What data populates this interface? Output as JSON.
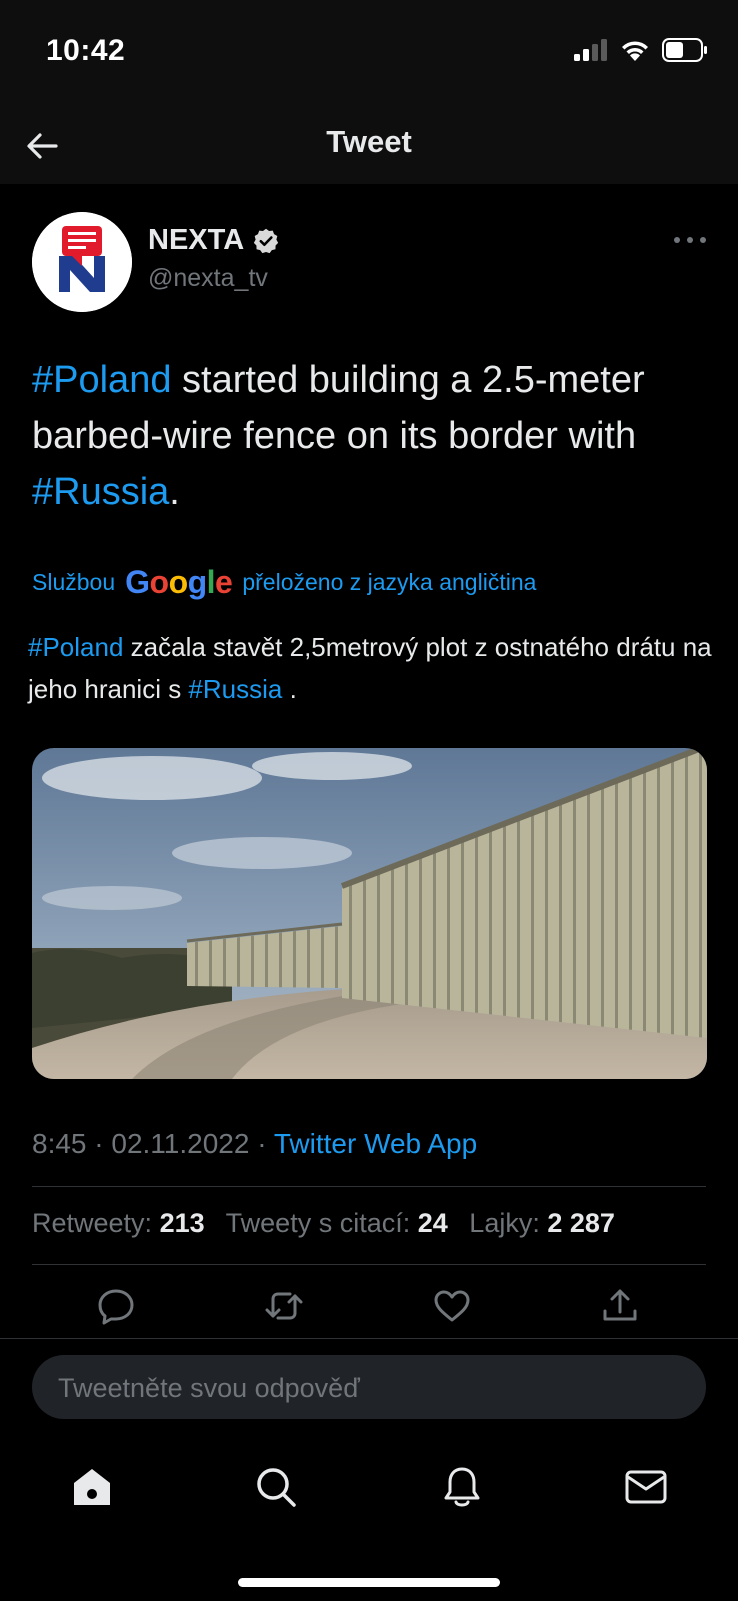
{
  "status_bar": {
    "time": "10:42"
  },
  "header": {
    "title": "Tweet"
  },
  "tweet": {
    "author_name": "NEXTA",
    "author_handle": "@nexta_tv",
    "text": {
      "hashtag1": "#Poland",
      "part1": " started building a 2.5-meter barbed-wire fence on its border with ",
      "hashtag2": "#Russia",
      "part2": "."
    },
    "translation": {
      "prefix": "Službou",
      "provider": "Google",
      "suffix": "přeloženo z jazyka angličtina",
      "hashtag1": "#Poland",
      "part1": " začala stavět 2,5metrový plot z ostnatého drátu na jeho hranici s ",
      "hashtag2": "#Russia",
      "part2": " ."
    },
    "timestamp": "8:45 · 02.11.2022 · ",
    "source_app": "Twitter Web App",
    "stats": {
      "retweets_label": "Retweety:",
      "retweets_value": "213",
      "quotes_label": "Tweety s citací:",
      "quotes_value": "24",
      "likes_label": "Lajky:",
      "likes_value": "2 287"
    }
  },
  "reply": {
    "placeholder": "Tweetněte svou odpověď"
  },
  "icons": {
    "back": "back-arrow-icon",
    "verified": "verified-badge-icon",
    "more": "more-icon",
    "reply": "reply-icon",
    "retweet": "retweet-icon",
    "like": "heart-icon",
    "share": "share-icon",
    "home": "home-icon",
    "search": "search-icon",
    "notifications": "bell-icon",
    "messages": "mail-icon"
  },
  "colors": {
    "accent": "#1d9bf0",
    "background": "#000000",
    "text": "#e7e9ea",
    "muted": "#71767b"
  }
}
